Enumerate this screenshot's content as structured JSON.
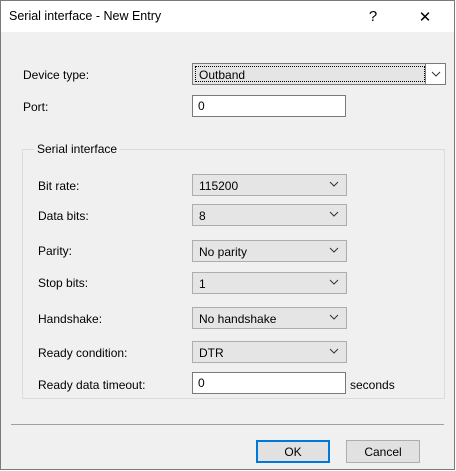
{
  "window": {
    "title": "Serial interface - New Entry",
    "help_glyph": "?",
    "close_glyph": "✕"
  },
  "device_type": {
    "label": "Device type:",
    "value": "Outband"
  },
  "port": {
    "label": "Port:",
    "value": "0"
  },
  "group": {
    "title": "Serial interface",
    "bit_rate": {
      "label": "Bit rate:",
      "value": "115200"
    },
    "data_bits": {
      "label": "Data bits:",
      "value": "8"
    },
    "parity": {
      "label": "Parity:",
      "value": "No parity"
    },
    "stop_bits": {
      "label": "Stop bits:",
      "value": "1"
    },
    "handshake": {
      "label": "Handshake:",
      "value": "No handshake"
    },
    "ready_condition": {
      "label": "Ready condition:",
      "value": "DTR"
    },
    "ready_data_timeout": {
      "label": "Ready data timeout:",
      "value": "0",
      "unit": "seconds"
    }
  },
  "buttons": {
    "ok": "OK",
    "cancel": "Cancel"
  },
  "icons": {
    "dropdown": "chevron-down-icon",
    "help": "help-icon",
    "close": "close-icon"
  }
}
